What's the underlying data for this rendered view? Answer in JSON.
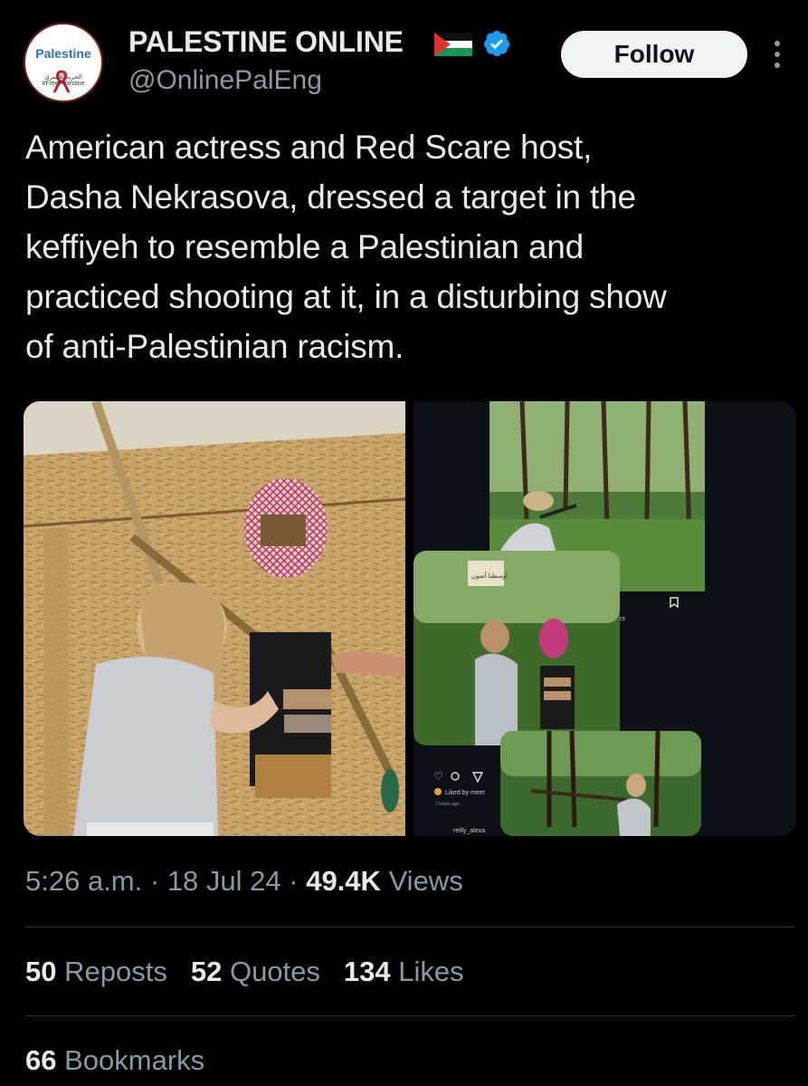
{
  "account": {
    "display_name": "PALESTINE ONLINE",
    "handle": "@OnlinePalEng",
    "avatar_text": "Palestine",
    "avatar_subtext": "الحرية للأسرى #FreePalestine",
    "follow_label": "Follow"
  },
  "tweet": {
    "text_lines": [
      "American actress and Red Scare host,",
      "Dasha Nekrasova, dressed a target in the",
      "keffiyeh to resemble a Palestinian and",
      "practiced shooting at it, in a disturbing show",
      "of anti-Palestinian racism."
    ]
  },
  "media": {
    "instagram_overlay": {
      "sign_text": "أوسطنا أصون",
      "liked_by": "Liked by meet",
      "time_ago": "2 hours ago",
      "commenter": "reilly_alexa",
      "edge_text": "rs"
    }
  },
  "meta": {
    "time": "5:26 a.m.",
    "separator": " · ",
    "date": "18 Jul 24",
    "views_count": "49.4K",
    "views_label": "Views"
  },
  "stats": {
    "reposts_count": "50",
    "reposts_label": "Reposts",
    "quotes_count": "52",
    "quotes_label": "Quotes",
    "likes_count": "134",
    "likes_label": "Likes",
    "bookmarks_count": "66",
    "bookmarks_label": "Bookmarks"
  },
  "colors": {
    "background": "#000000",
    "text_primary": "#e7e9ea",
    "text_secondary": "#8b98a5",
    "verified_blue": "#1d9bf0",
    "follow_bg": "#eff3f4",
    "divider": "#2f3336"
  },
  "icons": [
    "verified-badge-icon",
    "palestine-flag-icon",
    "more-options-icon",
    "share-icon",
    "bookmark-icon"
  ]
}
